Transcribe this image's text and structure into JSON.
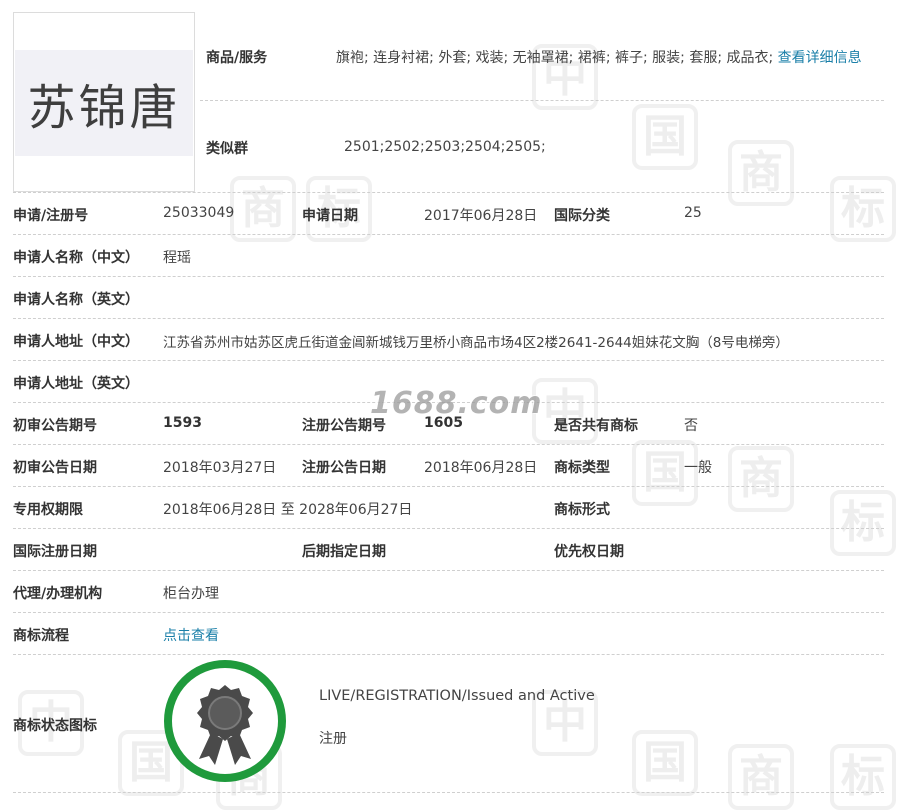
{
  "trademark": {
    "logo_text": "苏锦唐"
  },
  "goods": {
    "label": "商品/服务",
    "value": "旗袍; 连身衬裙; 外套; 戏装; 无袖罩裙; 裙裤; 裤子; 服装; 套服; 成品衣;",
    "link": "查看详细信息"
  },
  "similar_group": {
    "label": "类似群",
    "value": "2501;2502;2503;2504;2505;"
  },
  "row_reg": {
    "label": "申请/注册号",
    "value": "25033049",
    "date_label": "申请日期",
    "date_value": "2017年06月28日",
    "class_label": "国际分类",
    "class_value": "25"
  },
  "applicant_cn": {
    "label": "申请人名称（中文）",
    "value": "程瑶"
  },
  "applicant_en": {
    "label": "申请人名称（英文）",
    "value": ""
  },
  "address_cn": {
    "label": "申请人地址（中文）",
    "value": "江苏省苏州市姑苏区虎丘街道金阊新城钱万里桥小商品市场4区2楼2641-2644姐妹花文胸（8号电梯旁）"
  },
  "address_en": {
    "label": "申请人地址（英文）",
    "value": ""
  },
  "row_pub": {
    "label": "初审公告期号",
    "value": "1593",
    "reg_label": "注册公告期号",
    "reg_value": "1605",
    "shared_label": "是否共有商标",
    "shared_value": "否"
  },
  "row_pubdate": {
    "label": "初审公告日期",
    "value": "2018年03月27日",
    "reg_label": "注册公告日期",
    "reg_value": "2018年06月28日",
    "type_label": "商标类型",
    "type_value": "一般"
  },
  "row_term": {
    "label": "专用权期限",
    "value": "2018年06月28日 至 2028年06月27日",
    "form_label": "商标形式",
    "form_value": ""
  },
  "row_intl": {
    "label": "国际注册日期",
    "later_label": "后期指定日期",
    "priority_label": "优先权日期"
  },
  "agent": {
    "label": "代理/办理机构",
    "value": "柜台办理"
  },
  "process": {
    "label": "商标流程",
    "link": "点击查看"
  },
  "status": {
    "label": "商标状态图标",
    "en": "LIVE/REGISTRATION/Issued and Active",
    "cn": "注册",
    "ring_color": "#1f9a3c",
    "badge_color": "#4a4a4a"
  },
  "watermark": {
    "site": "1688.com",
    "chars": [
      "中",
      "国",
      "商",
      "标"
    ]
  }
}
